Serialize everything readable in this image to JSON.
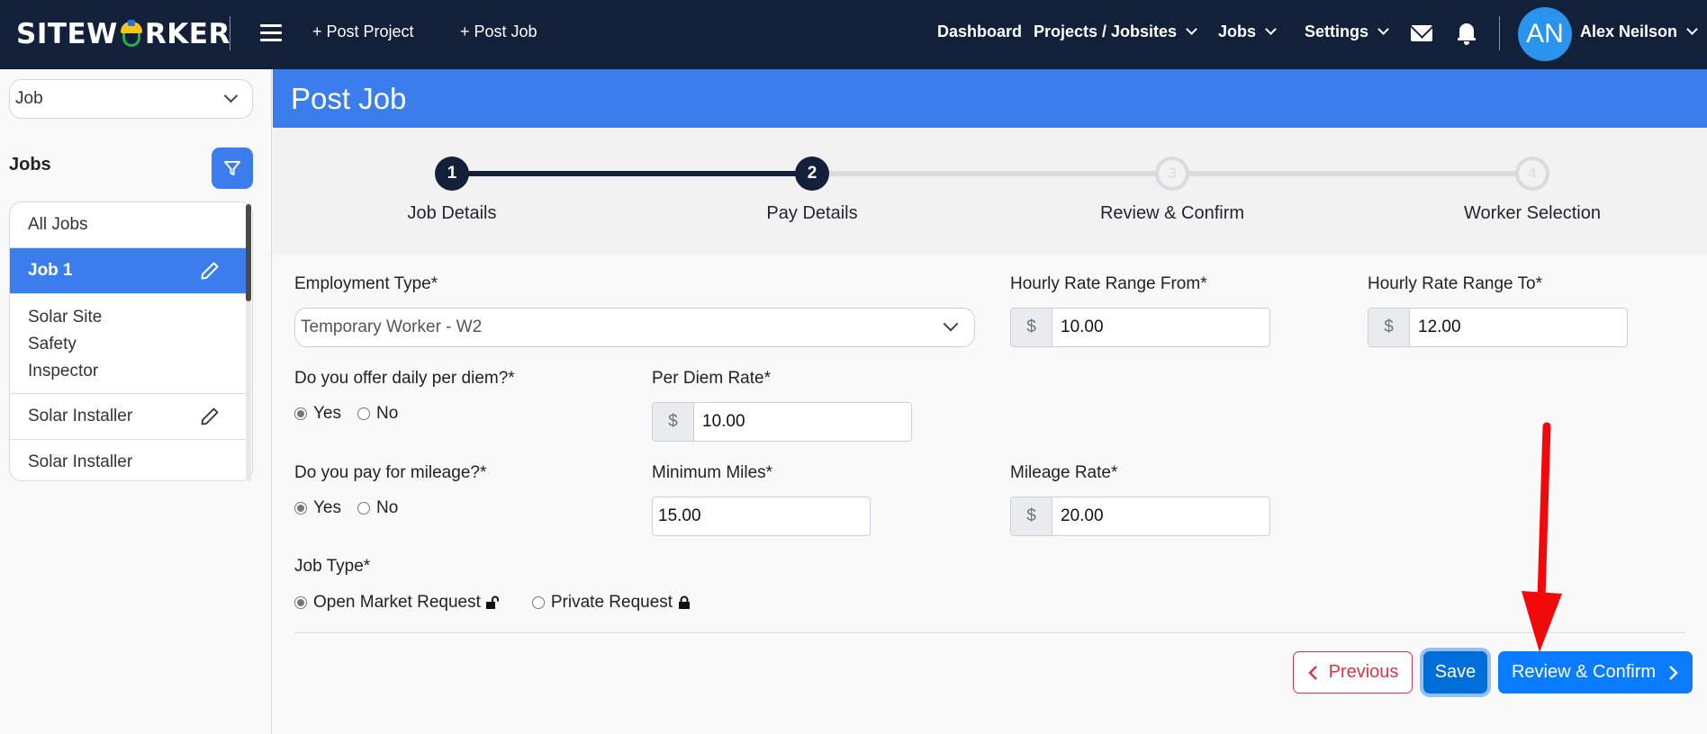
{
  "header": {
    "logo_text_left": "SITEW",
    "logo_text_right": "RKER",
    "post_project": "+ Post Project",
    "post_job": "+ Post Job",
    "nav": [
      {
        "label": "Dashboard",
        "has_dropdown": false
      },
      {
        "label": "Projects / Jobsites",
        "has_dropdown": true
      },
      {
        "label": "Jobs",
        "has_dropdown": true
      },
      {
        "label": "Settings",
        "has_dropdown": true
      }
    ],
    "icons": [
      "mail-icon",
      "bell-icon"
    ],
    "avatar_initials": "AN",
    "user_name": "Alex Neilson",
    "colors": {
      "bg": "#13203a",
      "avatar": "#2a93ee"
    }
  },
  "sidebar": {
    "select_value": "Job",
    "jobs_heading": "Jobs",
    "filter_icon": "filter-icon",
    "items": [
      {
        "label": "All Jobs",
        "active": false,
        "editable": false
      },
      {
        "label": "Job 1",
        "active": true,
        "editable": true
      },
      {
        "label": "Solar Site Safety Inspector",
        "lines": [
          "Solar Site",
          "Safety",
          "Inspector"
        ],
        "active": false,
        "editable": false
      },
      {
        "label": "Solar Installer",
        "active": false,
        "editable": true
      },
      {
        "label": "Solar Installer",
        "active": false,
        "editable": false
      }
    ]
  },
  "page": {
    "title": "Post Job",
    "accent": "#3b7ded"
  },
  "steps": [
    {
      "number": "1",
      "label": "Job Details",
      "status": "done"
    },
    {
      "number": "2",
      "label": "Pay Details",
      "status": "current"
    },
    {
      "number": "3",
      "label": "Review & Confirm",
      "status": "todo"
    },
    {
      "number": "4",
      "label": "Worker Selection",
      "status": "todo"
    }
  ],
  "form": {
    "employment_type": {
      "label": "Employment Type*",
      "value": "Temporary Worker - W2"
    },
    "hourly_from": {
      "label": "Hourly Rate Range From*",
      "prefix": "$",
      "value": "10.00"
    },
    "hourly_to": {
      "label": "Hourly Rate Range To*",
      "prefix": "$",
      "value": "12.00"
    },
    "per_diem_question": {
      "label": "Do you offer daily per diem?*",
      "options": [
        "Yes",
        "No"
      ],
      "selected": "Yes"
    },
    "per_diem_rate": {
      "label": "Per Diem Rate*",
      "prefix": "$",
      "value": "10.00"
    },
    "mileage_question": {
      "label": "Do you pay for mileage?*",
      "options": [
        "Yes",
        "No"
      ],
      "selected": "Yes"
    },
    "minimum_miles": {
      "label": "Minimum Miles*",
      "value": "15.00"
    },
    "mileage_rate": {
      "label": "Mileage Rate*",
      "prefix": "$",
      "value": "20.00"
    },
    "job_type": {
      "label": "Job Type*",
      "options": [
        "Open Market Request",
        "Private Request"
      ],
      "selected": "Open Market Request"
    }
  },
  "buttons": {
    "previous": "Previous",
    "save": "Save",
    "next": "Review & Confirm"
  },
  "annotation": {
    "type": "red-arrow",
    "color": "#f20a0a",
    "points_to": "review-confirm-button"
  }
}
